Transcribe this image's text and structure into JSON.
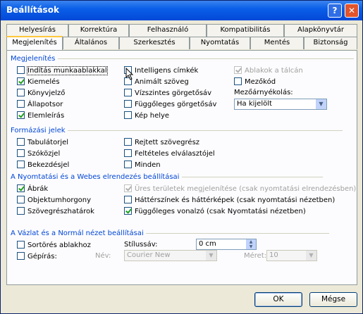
{
  "window": {
    "title": "Beállítások",
    "help_label": "?",
    "close_label": "✕"
  },
  "tabs_row1": [
    "Helyesírás",
    "Korrektúra",
    "Felhasználó",
    "Kompatibilitás",
    "Alapkönyvtár"
  ],
  "tabs_row2": [
    "Megjelenítés",
    "Általános",
    "Szerkesztés",
    "Nyomtatás",
    "Mentés",
    "Biztonság"
  ],
  "sections": {
    "megjelenites": "Megjelenítés",
    "formazasi": "Formázási jelek",
    "nyomtatasi": "A Nyomtatási és a Webes elrendezés beállításai",
    "vazlat": "A Vázlat és a Normál nézet beállításai"
  },
  "megjelenites": {
    "col1": [
      {
        "label": "Indítás munkaablakkal",
        "checked": false
      },
      {
        "label": "Kiemelés",
        "checked": true
      },
      {
        "label": "Könyvjelző",
        "checked": false
      },
      {
        "label": "Állapotsor",
        "checked": false
      },
      {
        "label": "Elemleírás",
        "checked": true
      }
    ],
    "col2": [
      {
        "label": "Intelligens címkék",
        "checked": false
      },
      {
        "label": "Animált szöveg",
        "checked": false
      },
      {
        "label": "Vízszintes görgetősáv",
        "checked": false
      },
      {
        "label": "Függőleges görgetősáv",
        "checked": false
      },
      {
        "label": "Kép helye",
        "checked": false
      }
    ],
    "ablakok_talcan": "Ablakok a tálcán",
    "mezokod": "Mezőkód",
    "mezoarnyekolas_label": "Mezőárnyékolás:",
    "mezoarnyekolas_value": "Ha kijelölt"
  },
  "formazasi": {
    "col1": [
      "Tabulátorjel",
      "Szóközjel",
      "Bekezdésjel"
    ],
    "col2": [
      "Rejtett szövegrész",
      "Feltételes elválasztójel",
      "Minden"
    ]
  },
  "nyomtatasi": {
    "abrak": "Ábrák",
    "ures": "Üres területek megjelenítése (csak nyomtatási elrendezésben)",
    "objektum": "Objektumhorgony",
    "hatterszinek": "Háttérszínek és háttérképek (csak nyomtatási nézetben)",
    "szoveg": "Szövegrészhatárok",
    "fuggoleges": "Függőleges vonalzó (csak Nyomtatási nézetben)"
  },
  "vazlat": {
    "sortores": "Sortörés ablakhoz",
    "stilussav_label": "Stílussáv:",
    "stilussav_value": "0 cm",
    "gepiras": "Gépírás:",
    "nev_label": "Név:",
    "nev_value": "Courier New",
    "meret_label": "Méret:",
    "meret_value": "10"
  },
  "buttons": {
    "ok": "OK",
    "cancel": "Mégse"
  }
}
